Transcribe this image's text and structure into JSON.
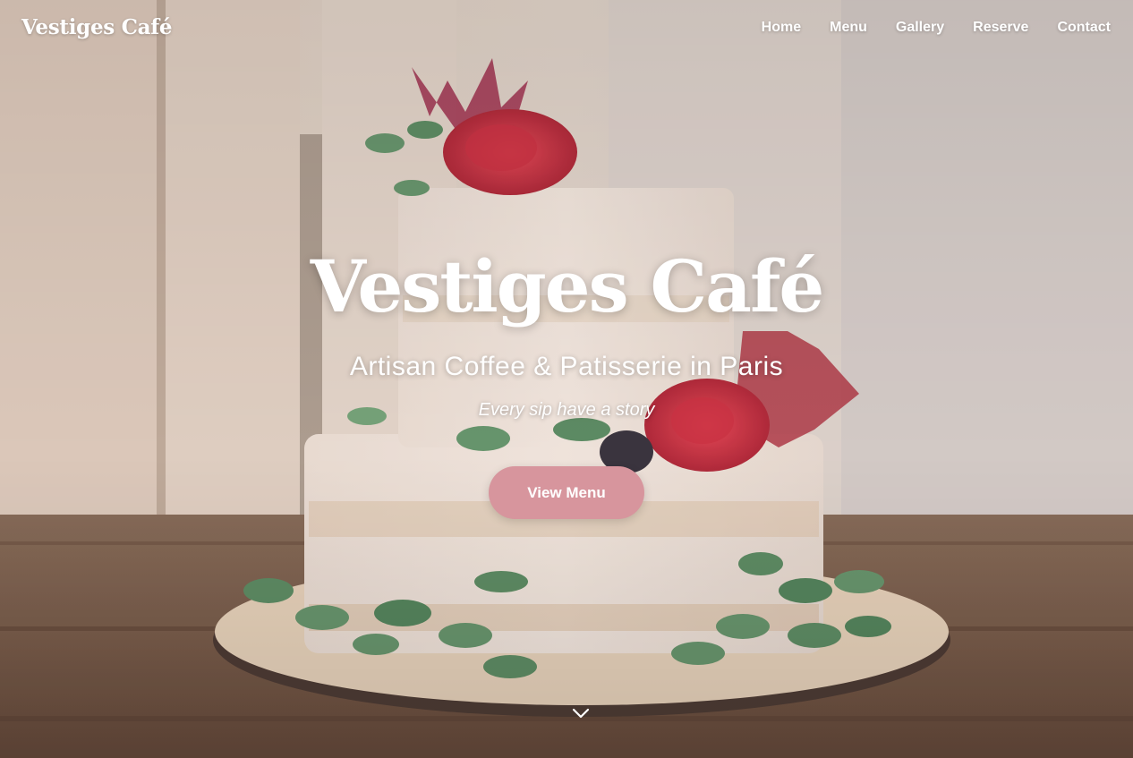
{
  "header": {
    "brand": "Vestiges Café",
    "nav": [
      "Home",
      "Menu",
      "Gallery",
      "Reserve",
      "Contact"
    ]
  },
  "hero": {
    "title": "Vestiges Café",
    "subtitle": "Artisan Coffee & Patisserie in Paris",
    "tagline": "Every sip have a story",
    "cta_label": "View Menu",
    "scroll_icon": "chevron-down-icon",
    "background": "cake-photo"
  },
  "colors": {
    "accent": "#d7959d",
    "text": "#ffffff"
  }
}
